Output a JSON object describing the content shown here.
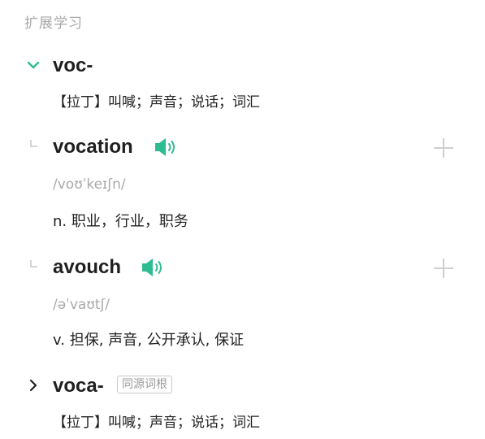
{
  "section": {
    "title": "扩展学习"
  },
  "colors": {
    "accent": "#2ebd93",
    "muted": "#a9a9a9",
    "text": "#222222"
  },
  "roots": [
    {
      "root": "voc-",
      "expanded": true,
      "toggle_icon": "chevron-down-icon",
      "meaning": "【拉丁】叫喊；声音；说话；词汇",
      "words": [
        {
          "word": "vocation",
          "phonetic": "/voʊˈkeɪʃn/",
          "definition": "n. 职业，行业，职务",
          "audio_icon": "speaker-icon",
          "add_icon": "plus-icon"
        },
        {
          "word": "avouch",
          "phonetic": "/əˈvaʊtʃ/",
          "definition": "v. 担保, 声音, 公开承认, 保证",
          "audio_icon": "speaker-icon",
          "add_icon": "plus-icon"
        }
      ]
    },
    {
      "root": "voca-",
      "expanded": false,
      "toggle_icon": "chevron-right-icon",
      "tag": "同源词根",
      "meaning": "【拉丁】叫喊；声音；说话；词汇"
    }
  ]
}
